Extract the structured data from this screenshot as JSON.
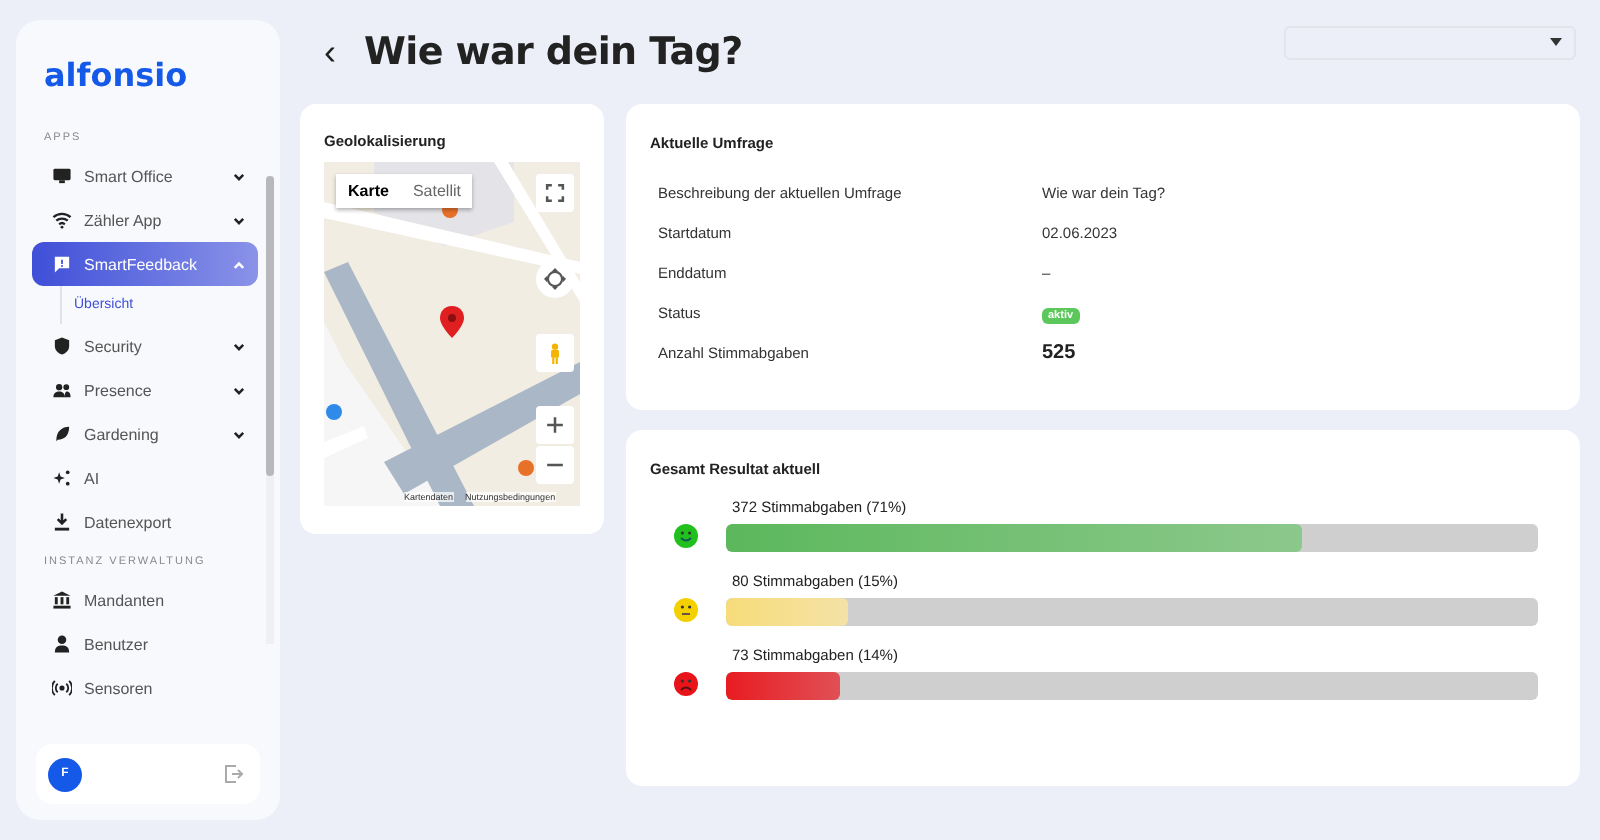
{
  "sidebar": {
    "logo": "alfonsio",
    "sections": [
      {
        "title": "APPS",
        "items": [
          {
            "kind": "group",
            "label": "Smart Office",
            "selected": false,
            "expanded": false
          },
          {
            "kind": "group",
            "label": "Zähler App",
            "selected": false,
            "expanded": false
          },
          {
            "kind": "group",
            "label": "SmartFeedback",
            "selected": true,
            "expanded": true,
            "children": [
              {
                "label": "Übersicht",
                "selected": true
              }
            ]
          },
          {
            "kind": "group",
            "label": "Security",
            "selected": false,
            "expanded": false
          },
          {
            "kind": "group",
            "label": "Presence",
            "selected": false,
            "expanded": false
          },
          {
            "kind": "group",
            "label": "Gardening",
            "selected": false,
            "expanded": false
          },
          {
            "kind": "link",
            "label": "AI",
            "selected": false
          },
          {
            "kind": "link",
            "label": "Datenexport",
            "selected": false
          }
        ]
      },
      {
        "title": "INSTANZ VERWALTUNG",
        "items": [
          {
            "kind": "link",
            "label": "Mandanten",
            "selected": false
          },
          {
            "kind": "link",
            "label": "Benutzer",
            "selected": false
          },
          {
            "kind": "link",
            "label": "Sensoren",
            "selected": false
          }
        ]
      }
    ],
    "user": {
      "initial": "F"
    }
  },
  "header": {
    "back": "‹",
    "title": "Wie war dein Tag?"
  },
  "map_card": {
    "title": "Geolokalisierung",
    "map_types": [
      {
        "label": "Karte",
        "selected": true
      },
      {
        "label": "Satellit",
        "selected": false
      }
    ],
    "footer": [
      "Kartendaten",
      "Nutzungsbedingungen"
    ]
  },
  "survey_card": {
    "title": "Aktuelle Umfrage",
    "rows": [
      {
        "kind": "text",
        "label": "Beschreibung der aktuellen Umfrage",
        "value": "Wie war dein Tag?"
      },
      {
        "kind": "text",
        "label": "Startdatum",
        "value": "02.06.2023"
      },
      {
        "kind": "text",
        "label": "Enddatum",
        "value": "–"
      },
      {
        "kind": "badge",
        "label": "Status",
        "value": "aktiv"
      },
      {
        "kind": "bold",
        "label": "Anzahl Stimmabgaben",
        "value": "525"
      }
    ]
  },
  "results_card": {
    "title": "Gesamt Resultat aktuell",
    "results": [
      {
        "kind": "happy",
        "color": "#22c01e",
        "label": "372 Stimmabgaben (71%)",
        "level": 0.71
      },
      {
        "kind": "neutral",
        "color": "#f5d000",
        "label": "80 Stimmabgaben (15%)",
        "level": 0.15
      },
      {
        "kind": "sad",
        "color": "#e8141a",
        "label": "73 Stimmabgaben (14%)",
        "level": 0.14
      }
    ]
  }
}
